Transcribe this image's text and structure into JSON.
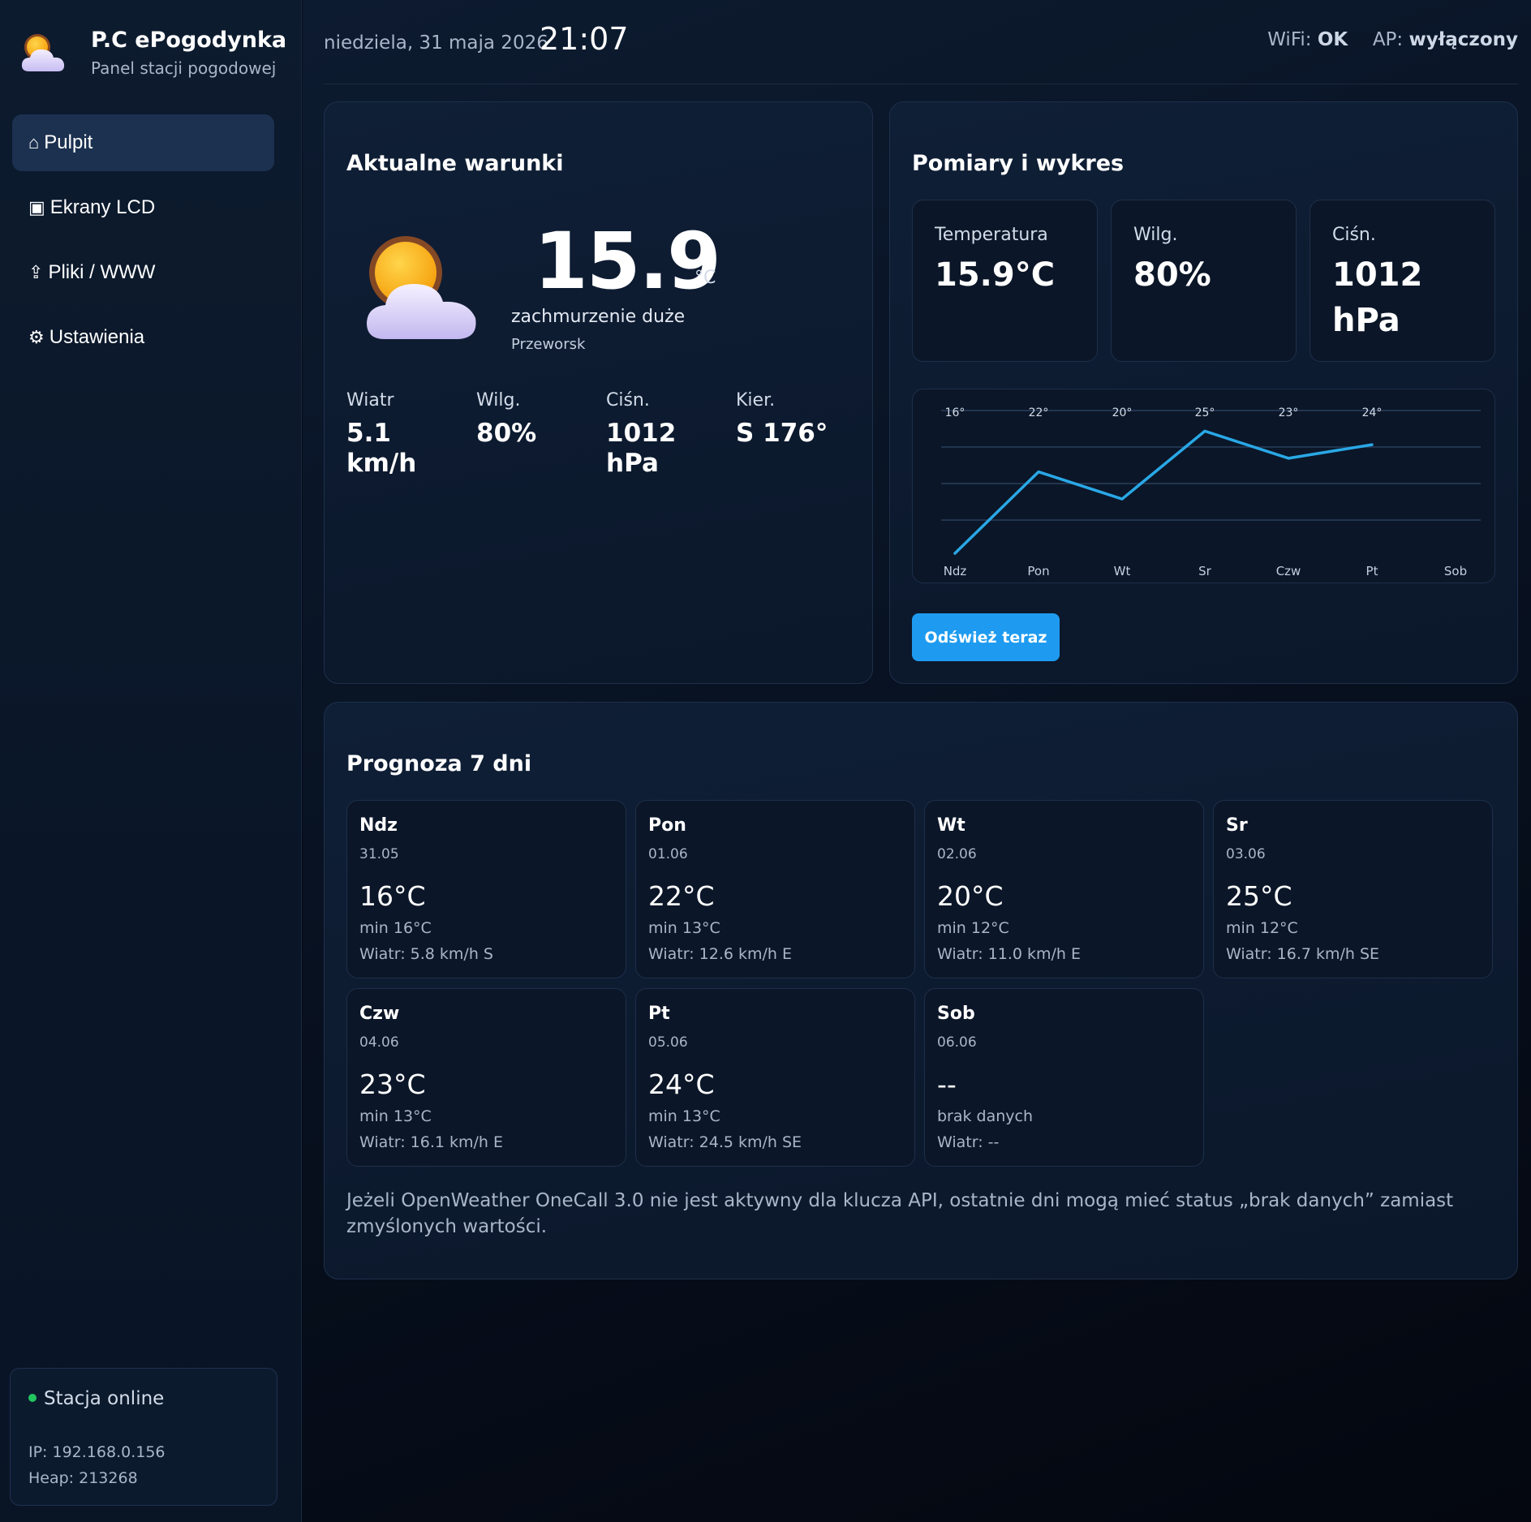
{
  "brand": {
    "title": "P.C ePogodynka",
    "subtitle": "Panel stacji pogodowej",
    "icon": "sun-cloud-icon"
  },
  "nav": {
    "items": [
      {
        "icon": "⌂",
        "icon_name": "home-icon",
        "label": "Pulpit",
        "active": true
      },
      {
        "icon": "▣",
        "icon_name": "screen-icon",
        "label": "Ekrany LCD",
        "active": false
      },
      {
        "icon": "⇪",
        "icon_name": "upload-icon",
        "label": "Pliki / WWW",
        "active": false
      },
      {
        "icon": "⚙",
        "icon_name": "gear-icon",
        "label": "Ustawienia",
        "active": false
      }
    ]
  },
  "status": {
    "online": "Stacja online",
    "ip": "IP: 192.168.0.156",
    "heap": "Heap: 213268",
    "dot_color": "#22c55e"
  },
  "topbar": {
    "date": "niedziela, 31 maja 2026",
    "time": "21:07",
    "wifi_label": "WiFi:",
    "wifi_value": "OK",
    "ap_label": "AP:",
    "ap_value": "wyłączony"
  },
  "current": {
    "title": "Aktualne warunki",
    "temp": "15.9",
    "unit": "°C",
    "description": "zachmurzenie duże",
    "city": "Przeworsk",
    "metrics": [
      {
        "label": "Wiatr",
        "value": "5.1 km/h"
      },
      {
        "label": "Wilg.",
        "value": "80%"
      },
      {
        "label": "Ciśn.",
        "value": "1012 hPa"
      },
      {
        "label": "Kier.",
        "value": "S 176°"
      }
    ]
  },
  "measure": {
    "title": "Pomiary i wykres",
    "boxes": [
      {
        "label": "Temperatura",
        "value": "15.9°C"
      },
      {
        "label": "Wilg.",
        "value": "80%"
      },
      {
        "label": "Ciśn.",
        "value": "1012 hPa"
      }
    ],
    "refresh_label": "Odśwież teraz"
  },
  "chart_data": {
    "type": "line",
    "categories": [
      "Ndz",
      "Pon",
      "Wt",
      "Sr",
      "Czw",
      "Pt",
      "Sob"
    ],
    "values": [
      16,
      22,
      20,
      25,
      23,
      24,
      null
    ],
    "value_labels": [
      "16°",
      "22°",
      "20°",
      "25°",
      "23°",
      "24°"
    ],
    "ylim": [
      16,
      25.5
    ],
    "grid": true,
    "line_color": "#29a8e6"
  },
  "forecast": {
    "title": "Prognoza 7 dni",
    "days": [
      {
        "name": "Ndz",
        "date": "31.05",
        "temp": "16°C",
        "min": "min 16°C",
        "wind": "Wiatr: 5.8 km/h S"
      },
      {
        "name": "Pon",
        "date": "01.06",
        "temp": "22°C",
        "min": "min 13°C",
        "wind": "Wiatr: 12.6 km/h E"
      },
      {
        "name": "Wt",
        "date": "02.06",
        "temp": "20°C",
        "min": "min 12°C",
        "wind": "Wiatr: 11.0 km/h E"
      },
      {
        "name": "Sr",
        "date": "03.06",
        "temp": "25°C",
        "min": "min 12°C",
        "wind": "Wiatr: 16.7 km/h SE"
      },
      {
        "name": "Czw",
        "date": "04.06",
        "temp": "23°C",
        "min": "min 13°C",
        "wind": "Wiatr: 16.1 km/h E"
      },
      {
        "name": "Pt",
        "date": "05.06",
        "temp": "24°C",
        "min": "min 13°C",
        "wind": "Wiatr: 24.5 km/h SE"
      },
      {
        "name": "Sob",
        "date": "06.06",
        "temp": "--",
        "min": "brak danych",
        "wind": "Wiatr: --"
      }
    ],
    "note": "Jeżeli OpenWeather OneCall 3.0 nie jest aktywny dla klucza API, ostatnie dni mogą mieć status „brak danych” zamiast zmyślonych wartości."
  }
}
